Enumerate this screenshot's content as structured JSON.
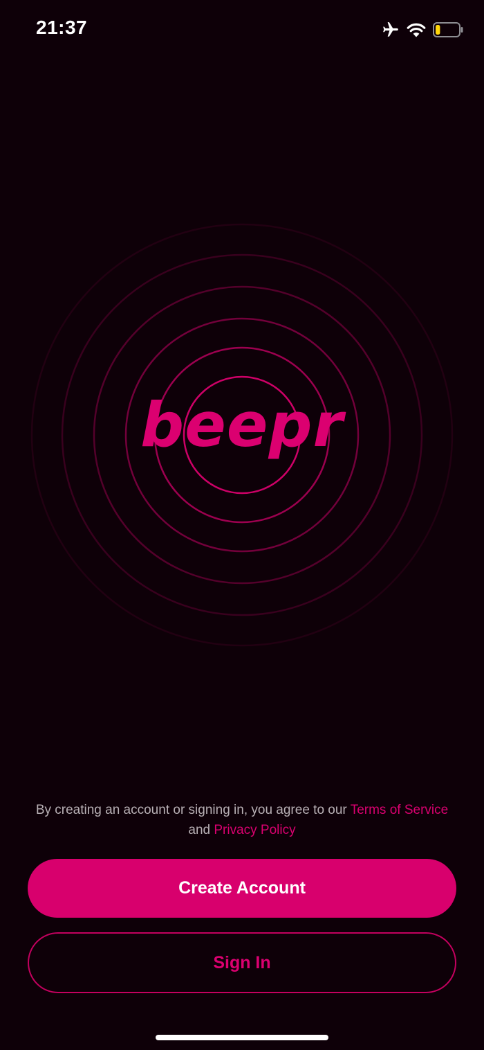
{
  "status_bar": {
    "time": "21:37",
    "icons": [
      "airplane-icon",
      "wifi-icon",
      "battery-icon"
    ],
    "battery_level": 0.2,
    "battery_color": "#ffd60a"
  },
  "logo": {
    "text": "beepr",
    "color": "#db0070"
  },
  "legal": {
    "prefix": "By creating an account or signing in, you agree to our ",
    "terms_link": "Terms of Service",
    "conjunction": " and ",
    "privacy_link": "Privacy Policy"
  },
  "buttons": {
    "create_account": "Create Account",
    "sign_in": "Sign In"
  },
  "colors": {
    "background": "#0e0008",
    "accent": "#d8006d",
    "legal_text": "#b8b0b5"
  }
}
